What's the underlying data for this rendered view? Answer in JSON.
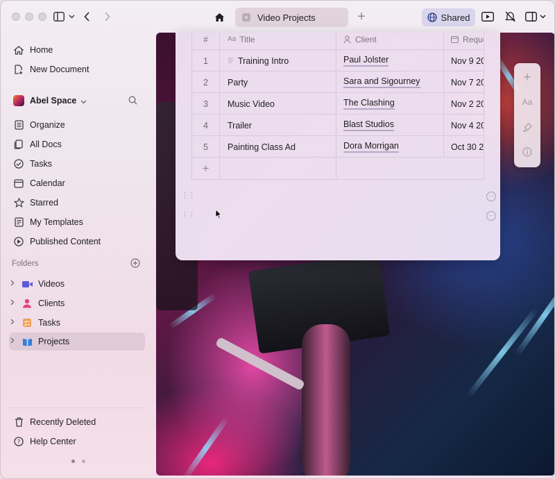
{
  "titlebar": {
    "tab_label": "Video Projects",
    "shared_label": "Shared"
  },
  "sidebar": {
    "top_items": [
      {
        "label": "Home",
        "icon": "home-icon"
      },
      {
        "label": "New Document",
        "icon": "new-document-icon"
      }
    ],
    "space_name": "Abel Space",
    "nav_items": [
      {
        "label": "Organize",
        "icon": "organize-icon"
      },
      {
        "label": "All Docs",
        "icon": "docs-icon"
      },
      {
        "label": "Tasks",
        "icon": "tasks-icon"
      },
      {
        "label": "Calendar",
        "icon": "calendar-icon"
      },
      {
        "label": "Starred",
        "icon": "star-icon"
      },
      {
        "label": "My Templates",
        "icon": "templates-icon"
      },
      {
        "label": "Published Content",
        "icon": "published-icon"
      }
    ],
    "folders_title": "Folders",
    "folders": [
      {
        "label": "Videos",
        "icon": "video-folder-icon",
        "color": "#5b5bd6"
      },
      {
        "label": "Clients",
        "icon": "clients-folder-icon",
        "color": "#e0457b"
      },
      {
        "label": "Tasks",
        "icon": "tasks-folder-icon",
        "color": "#f0a050"
      },
      {
        "label": "Projects",
        "icon": "projects-folder-icon",
        "color": "#2f7fe0"
      }
    ],
    "bottom_items": [
      {
        "label": "Recently Deleted",
        "icon": "trash-icon"
      },
      {
        "label": "Help Center",
        "icon": "help-icon"
      }
    ]
  },
  "table": {
    "headers": {
      "num": "#",
      "title": "Title",
      "client": "Client",
      "date": "Reque"
    },
    "rows": [
      {
        "num": "1",
        "title": "Training Intro",
        "client": "Paul Jolster",
        "date": "Nov 9 20"
      },
      {
        "num": "2",
        "title": "Party",
        "client": "Sara and Sigourney",
        "date": "Nov 7 20"
      },
      {
        "num": "3",
        "title": "Music Video",
        "client": "The Clashing",
        "date": "Nov 2 20"
      },
      {
        "num": "4",
        "title": "Trailer",
        "client": "Blast Studios",
        "date": "Nov 4 20"
      },
      {
        "num": "5",
        "title": "Painting Class Ad",
        "client": "Dora Morrigan",
        "date": "Oct 30 2"
      }
    ],
    "add_row": "+"
  },
  "colors": {
    "accent": "#d8d5ec",
    "card_bg": "#f1e5f6"
  }
}
